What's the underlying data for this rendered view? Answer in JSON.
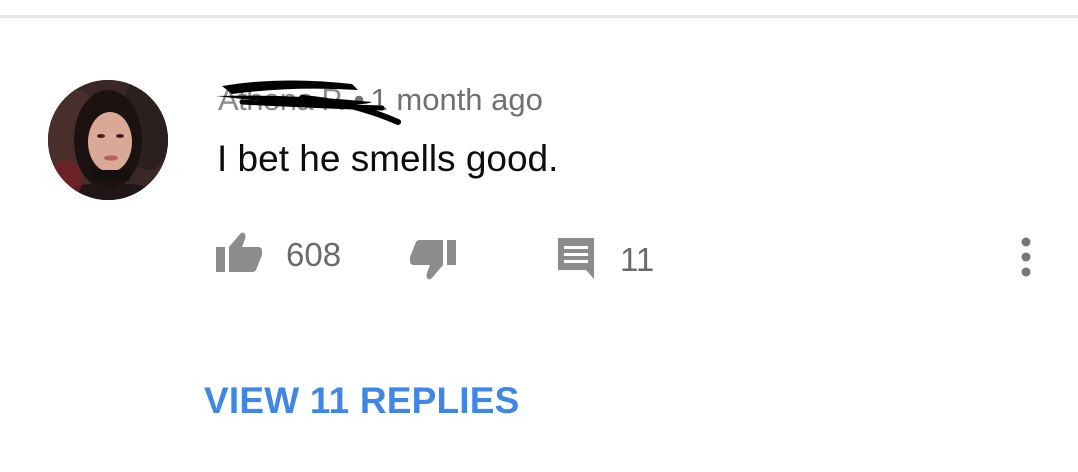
{
  "comment": {
    "author": "Athena P.",
    "separator": "•",
    "timestamp": "1 month ago",
    "text": "I bet he smells good."
  },
  "actions": {
    "like_count": "608",
    "reply_count": "11"
  },
  "view_replies_label": "VIEW 11 REPLIES",
  "colors": {
    "link": "#3f86e6",
    "icon": "#8c8c8c",
    "meta_text": "#707070"
  },
  "icons": {
    "like": "thumb-up-icon",
    "dislike": "thumb-down-icon",
    "reply": "comment-icon",
    "more": "more-vertical-icon"
  }
}
